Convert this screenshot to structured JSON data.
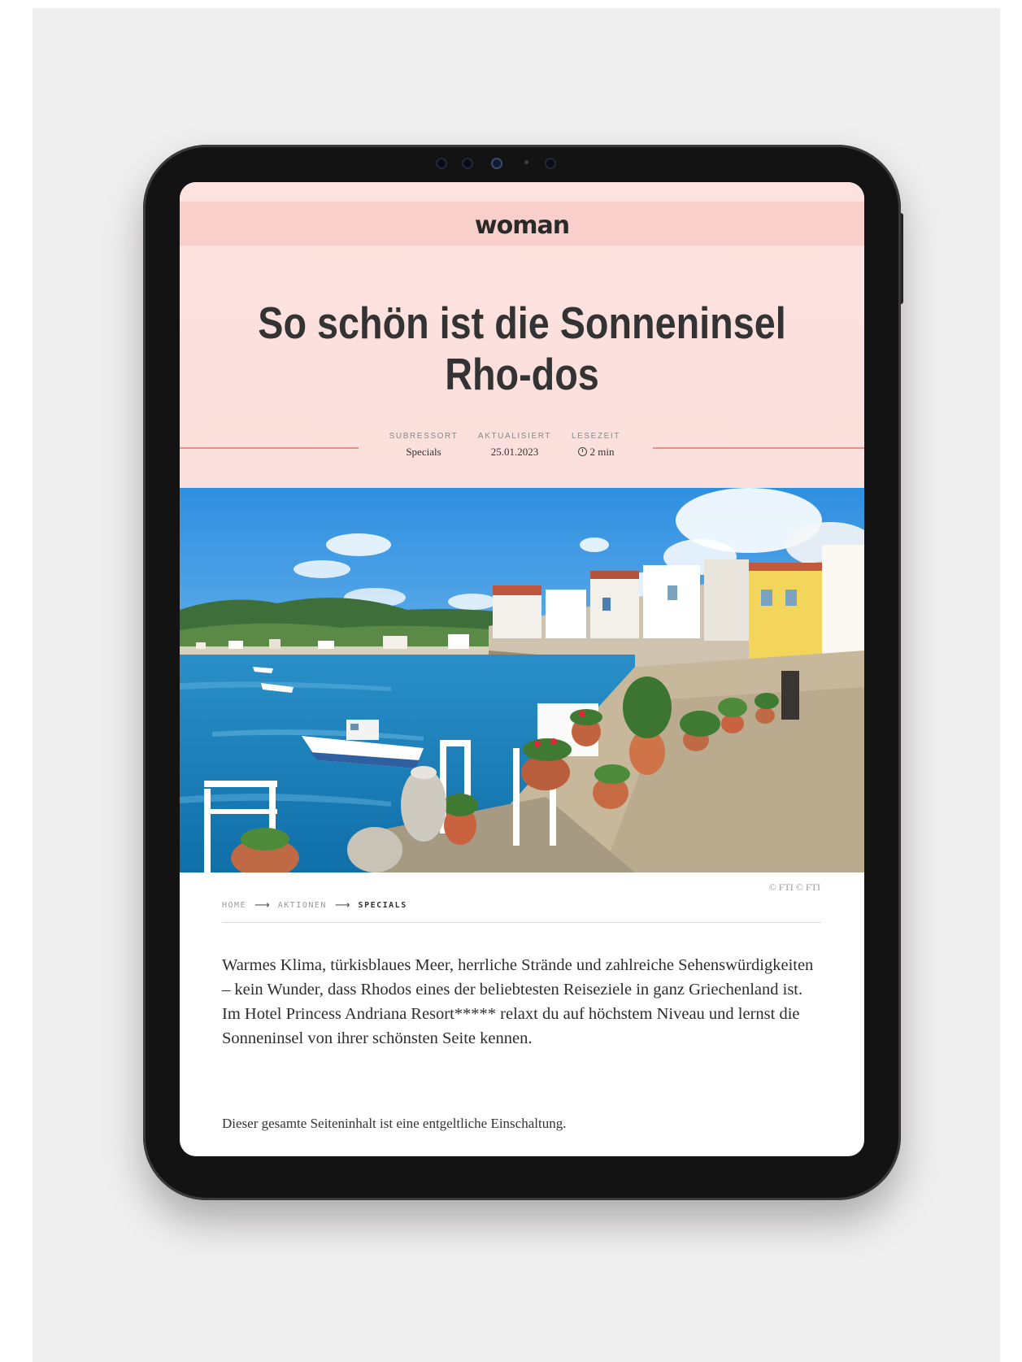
{
  "site": {
    "logo": "woman"
  },
  "article": {
    "title": "So schön ist die Sonneninsel Rho-dos",
    "meta": [
      {
        "label": "SUBRESSORT",
        "value": "Specials"
      },
      {
        "label": "AKTUALISIERT",
        "value": "25.01.2023"
      },
      {
        "label": "LESEZEIT",
        "value": "2 min"
      }
    ],
    "image_credit": "© FTI © FTI",
    "breadcrumb": [
      "HOME",
      "AKTIONEN",
      "SPECIALS"
    ],
    "lead": "Warmes Klima, türkisblaues Meer, herrliche Strände und zahlreiche Sehenswürdigkeiten – kein Wunder, dass Rhodos eines der beliebtesten Reiseziele in ganz Griechenland ist. Im Hotel Princess Andriana Resort***** relaxt du auf höchstem Niveau und lernst die Sonneninsel von ihrer schönsten Seite kennen.",
    "disclaimer": "Dieser gesamte Seiteninhalt ist eine entgeltliche Einschaltung."
  },
  "icons": {
    "reading_time": "clock-icon",
    "breadcrumb_separator": "arrow-right-icon"
  }
}
